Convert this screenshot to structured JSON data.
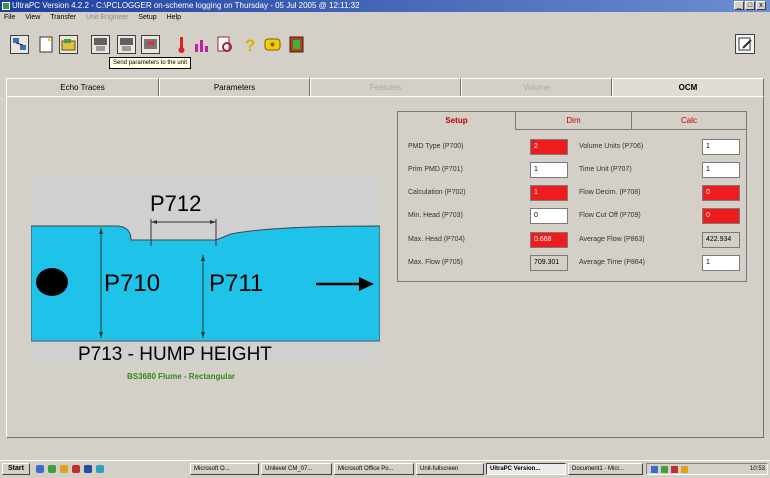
{
  "window": {
    "title": "UltraPC Version 4.2.2 - C:\\PCLOGGER on-scheme logging on Thursday - 05 Jul 2005 @ 12:11:32",
    "min_label": "_",
    "max_label": "□",
    "close_label": "x"
  },
  "menu": {
    "file": "File",
    "view": "View",
    "transfer": "Transfer",
    "unit_engineer": "Unit Engineer",
    "setup": "Setup",
    "help": "Help"
  },
  "toolbar": {
    "tooltip": "Send parameters to the unit"
  },
  "tabs": [
    {
      "label": "Echo Traces",
      "enabled": true
    },
    {
      "label": "Parameters",
      "enabled": true
    },
    {
      "label": "Features",
      "enabled": false
    },
    {
      "label": "Volume",
      "enabled": false
    },
    {
      "label": "OCM",
      "enabled": true
    }
  ],
  "diagram": {
    "dim_top": "P712",
    "dim_upstream": "P710",
    "dim_throat": "P711",
    "hump_label": "P713 - HUMP HEIGHT",
    "caption": "BS3680 Flume - Rectangular"
  },
  "panel": {
    "tabs": [
      "Setup",
      "Dim",
      "Calc"
    ],
    "fields": {
      "pmd_type": {
        "label": "PMD Type (P700)",
        "value": "2"
      },
      "prim_pmd": {
        "label": "Prim PMD (P701)",
        "value": "1"
      },
      "calculation": {
        "label": "Calculation (P702)",
        "value": "1"
      },
      "min_head": {
        "label": "Min. Head (P703)",
        "value": "0"
      },
      "max_head": {
        "label": "Max. Head (P704)",
        "value": "0.668"
      },
      "max_flow": {
        "label": "Max. Flow (P705)",
        "value": "709.301"
      },
      "volume_units": {
        "label": "Volume Units (P706)",
        "value": "1"
      },
      "time_units": {
        "label": "Time Unit (P707)",
        "value": "1"
      },
      "flow_decim": {
        "label": "Flow Decim. (P708)",
        "value": "0"
      },
      "flow_cutoff": {
        "label": "Flow Cut Off (P709)",
        "value": "0"
      },
      "average_flow": {
        "label": "Average Flow (P863)",
        "value": "422.934"
      },
      "average_time": {
        "label": "Average Time (P864)",
        "value": "1"
      }
    }
  },
  "taskbar": {
    "start": "Start",
    "tasks": [
      "Microsoft O...",
      "Unilevel CM_07...",
      "Microsoft Office Po...",
      "Unit-fullscreen",
      "UltraPC Version...",
      "Document1 - Micr..."
    ],
    "clock": "10:53"
  },
  "colors": {
    "water": "#1fc3ea",
    "highlight_field": "#ee1c1c",
    "caption_green": "#2e8b1f",
    "panel_tab_red": "#c00000"
  }
}
